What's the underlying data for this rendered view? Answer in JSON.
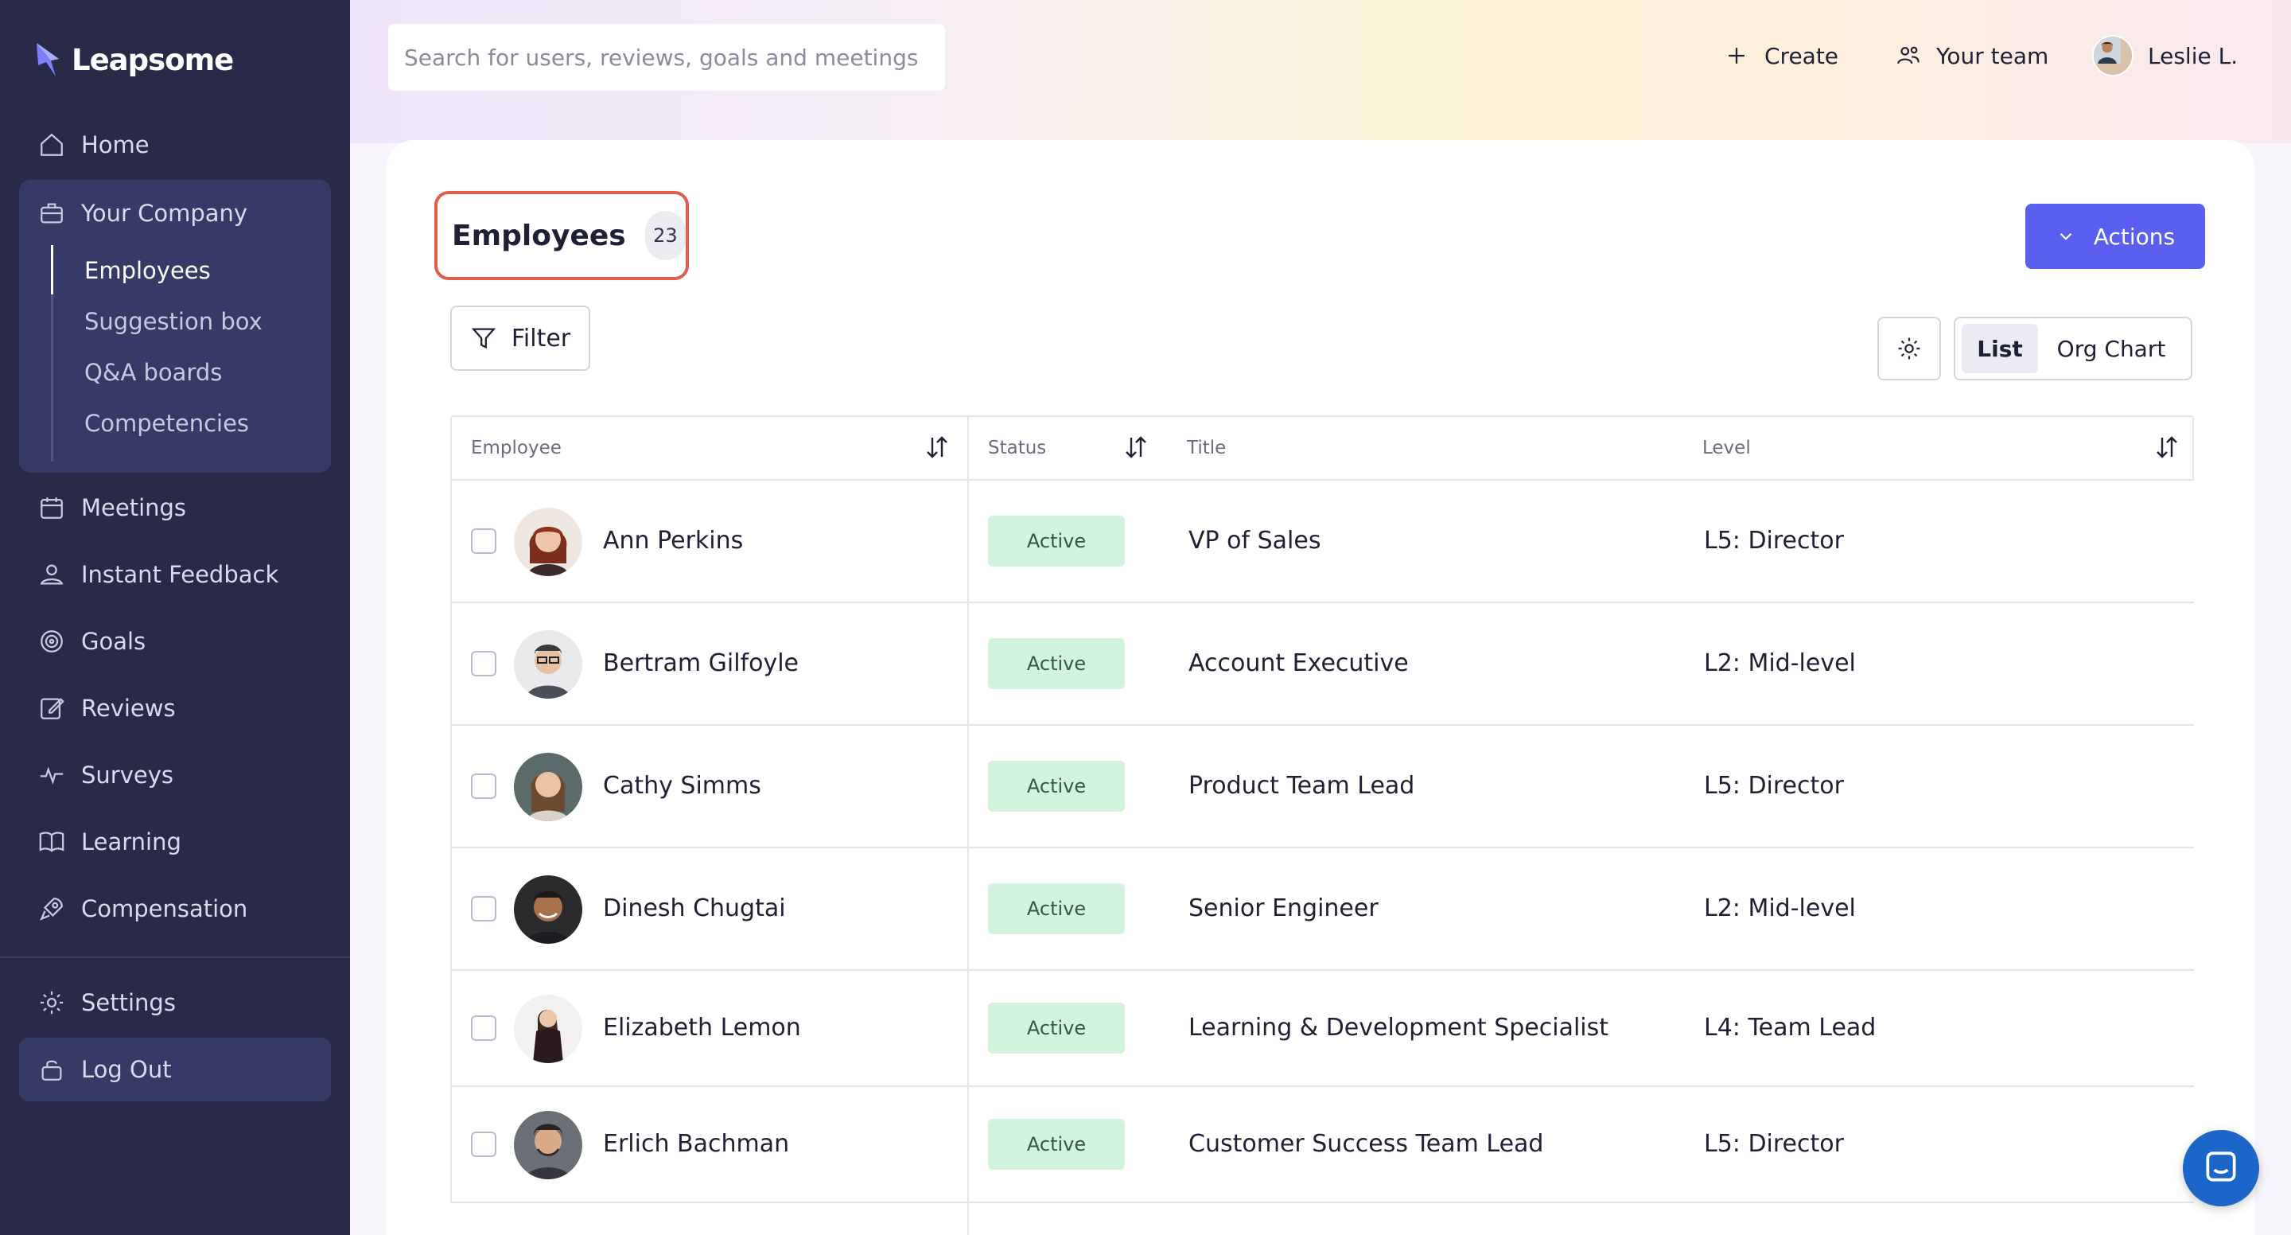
{
  "app": {
    "name": "Leapsome"
  },
  "sidebar": {
    "home": "Home",
    "company": {
      "label": "Your Company",
      "items": [
        "Employees",
        "Suggestion box",
        "Q&A boards",
        "Competencies"
      ]
    },
    "items": [
      {
        "label": "Meetings",
        "icon": "calendar-icon"
      },
      {
        "label": "Instant Feedback",
        "icon": "feedback-icon"
      },
      {
        "label": "Goals",
        "icon": "target-icon"
      },
      {
        "label": "Reviews",
        "icon": "edit-icon"
      },
      {
        "label": "Surveys",
        "icon": "pulse-icon"
      },
      {
        "label": "Learning",
        "icon": "book-icon"
      },
      {
        "label": "Compensation",
        "icon": "rocket-icon"
      }
    ],
    "settings": "Settings",
    "logout": "Log Out"
  },
  "topbar": {
    "search_placeholder": "Search for users, reviews, goals and meetings",
    "create": "Create",
    "team": "Your team",
    "user": "Leslie L."
  },
  "page": {
    "title": "Employees",
    "count": "23",
    "actions": "Actions",
    "filter": "Filter",
    "view_list": "List",
    "view_org": "Org Chart"
  },
  "table": {
    "headers": {
      "employee": "Employee",
      "status": "Status",
      "title": "Title",
      "level": "Level"
    },
    "rows": [
      {
        "name": "Ann Perkins",
        "status": "Active",
        "title": "VP of Sales",
        "level": "L5: Director"
      },
      {
        "name": "Bertram Gilfoyle",
        "status": "Active",
        "title": "Account Executive",
        "level": "L2: Mid-level"
      },
      {
        "name": "Cathy Simms",
        "status": "Active",
        "title": "Product Team Lead",
        "level": "L5: Director"
      },
      {
        "name": "Dinesh Chugtai",
        "status": "Active",
        "title": "Senior Engineer",
        "level": "L2: Mid-level"
      },
      {
        "name": "Elizabeth Lemon",
        "status": "Active",
        "title": "Learning & Development Specialist",
        "level": "L4: Team Lead"
      },
      {
        "name": "Erlich Bachman",
        "status": "Active",
        "title": "Customer Success Team Lead",
        "level": "L5: Director"
      }
    ]
  },
  "colors": {
    "sidebar": "#282a47",
    "accent": "#5b5ff0",
    "active_pill": "#d4f3df",
    "highlight": "#e35c4c"
  }
}
